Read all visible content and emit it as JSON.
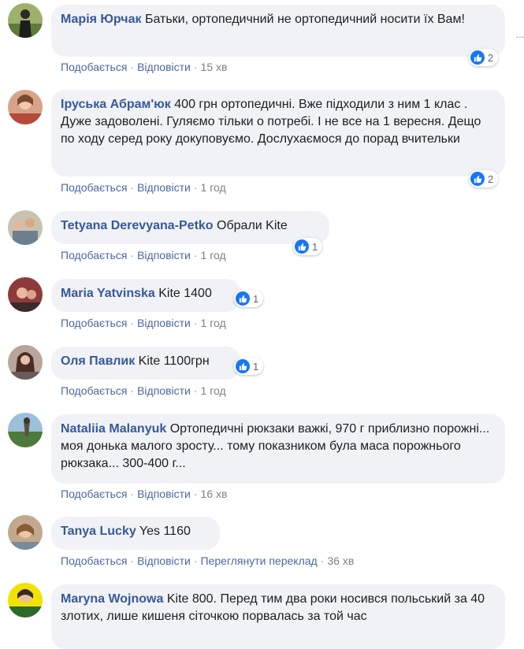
{
  "actions": {
    "like": "Подобається",
    "reply": "Відповісти",
    "translate": "Переглянути переклад",
    "separator": "·"
  },
  "accent": "#385898",
  "link_color": "#4b67a1",
  "bubble_color": "#f0f2f5",
  "comments": [
    {
      "author": "Марія Юрчак",
      "text": "Батьки, ортопедичний не ортопедичний носити їх Вам!",
      "time": "15 хв",
      "likes": "2",
      "avatar_icon": "user-photo"
    },
    {
      "author": "Іруська Абрам'юк",
      "text": "400 грн ортопедичні. Вже підходили з ним 1 клас . Дуже задоволені. Гуляємо тільки о потребі. І не все на 1 вересня. Дещо по ходу серед року докуповуємо. Дослухаємося до порад вчительки",
      "time": "1 год",
      "likes": "2",
      "avatar_icon": "user-photo"
    },
    {
      "author": "Tetyana Derevyana-Petko",
      "text": "Обрали Kite",
      "time": "1 год",
      "likes": "1",
      "avatar_icon": "user-photo"
    },
    {
      "author": "Maria Yatvinska",
      "text": "Kite 1400",
      "time": "1 год",
      "likes": "1",
      "avatar_icon": "user-photo"
    },
    {
      "author": "Оля Павлик",
      "text": "Kite 1100грн",
      "time": "1 год",
      "likes": "1",
      "avatar_icon": "user-photo"
    },
    {
      "author": "Nataliia Malanyuk",
      "text": "Ортопедичні рюкзаки важкі, 970 г приблизно порожні... моя донька малого зросту... тому показником була маса порожнього рюкзака... 300-400 г...",
      "time": "16 хв",
      "likes": "",
      "avatar_icon": "user-photo"
    },
    {
      "author": "Tanya Lucky",
      "text": "Yes 1160",
      "time": "36 хв",
      "likes": "",
      "avatar_icon": "user-photo"
    },
    {
      "author": "Maryna Wojnowa",
      "text": "Kite 800. Перед тим два роки носився польський за 40 злотих, лише кишеня сіточкою порвалась за той час",
      "time": "",
      "likes": "",
      "avatar_icon": "user-photo"
    }
  ]
}
